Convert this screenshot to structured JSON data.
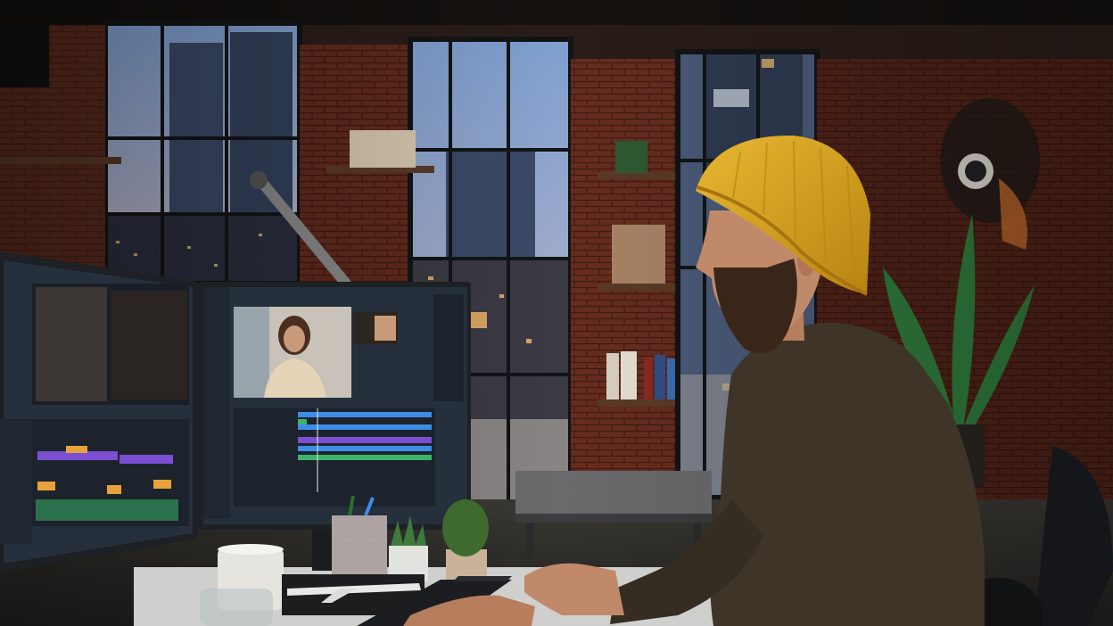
{
  "scene": {
    "subject": "video-editor-at-workstation",
    "colors": {
      "sky_top": "#7f9fcf",
      "sky_bottom": "#c8b8c0",
      "brick": "#7a3524",
      "brick_dark": "#4a2018",
      "beanie": "#d9a521",
      "sweater": "#3e3428",
      "skin": "#c08a6a",
      "beard": "#3a2618",
      "monitor_frame": "#1d2024",
      "editor_bg": "#25303c",
      "track_purple": "#7b4fd1",
      "track_blue": "#3d8de6",
      "track_green": "#3bb36a",
      "track_orange": "#e8a23a",
      "plant": "#2f7a3c"
    },
    "icons": [
      "coffee-mug-icon",
      "pencil-cup-icon",
      "succulent-icon",
      "airplane-model-icon",
      "keyboard-icon"
    ]
  }
}
